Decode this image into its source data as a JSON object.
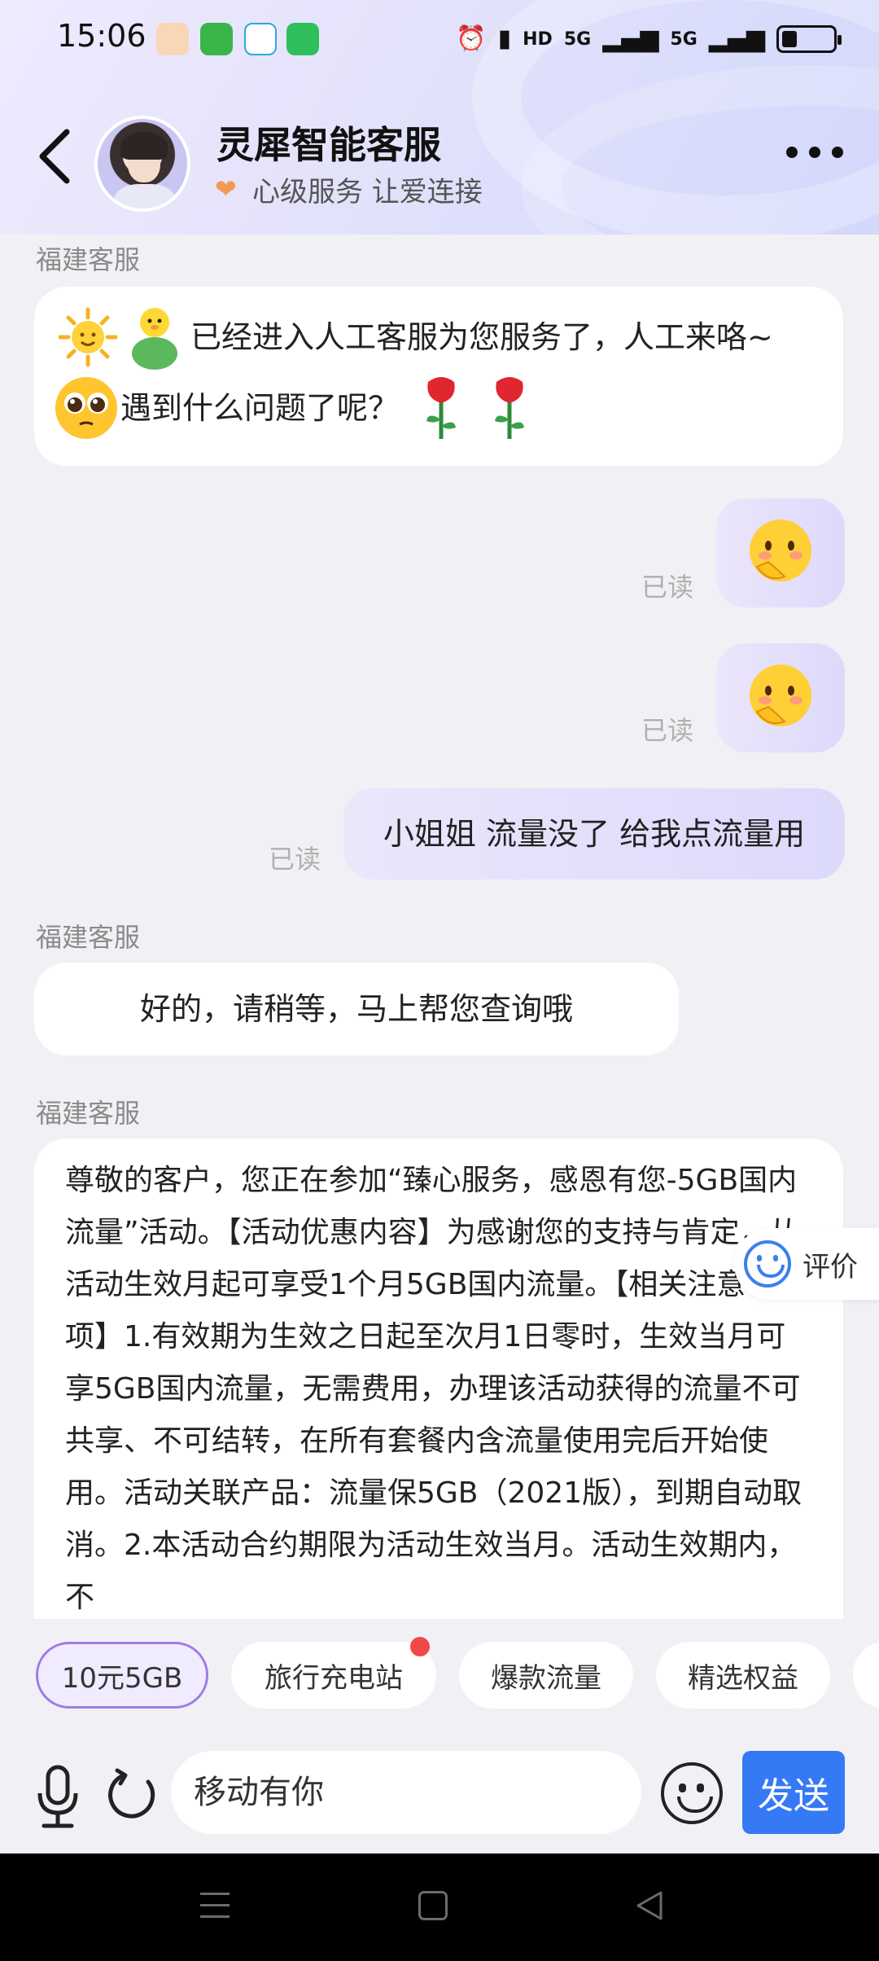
{
  "status_bar": {
    "time": "15:06",
    "network_hd": "HD",
    "network_5g_1": "5G",
    "network_5g_2": "5G"
  },
  "header": {
    "title": "灵犀智能客服",
    "subtitle": "心级服务 让爱连接"
  },
  "messages": {
    "sender_1": "福建客服",
    "welcome_line1": "已经进入人工客服为您服务了，人工来咯~",
    "welcome_line2": "遇到什么问题了呢？",
    "read_1": "已读",
    "read_2": "已读",
    "user_text": "小姐姐 流量没了 给我点流量用",
    "read_3": "已读",
    "sender_2": "福建客服",
    "reply_1": "好的，请稍等，马上帮您查询哦",
    "sender_3": "福建客服",
    "long_text": "尊敬的客户，您正在参加“臻心服务，感恩有您-5GB国内流量”活动。【活动优惠内容】为感谢您的支持与肯定，从活动生效月起可享受1个月5GB国内流量。【相关注意事项】1.有效期为生效之日起至次月1日零时，生效当月可享5GB国内流量，无需费用，办理该活动获得的流量不可共享、不可结转，在所有套餐内含流量使用完后开始使用。活动关联产品：流量保5GB（2021版），到期自动取消。2.本活动合约期限为活动生效当月。活动生效期内，不"
  },
  "rating": {
    "label": "评价"
  },
  "chips": [
    "10元5GB",
    "旅行充电站",
    "爆款流量",
    "精选权益"
  ],
  "input": {
    "value": "移动有你"
  },
  "send_label": "发送",
  "colors": {
    "accent": "#3679f5",
    "chip_active_border": "#a07be8",
    "badge": "#f24848"
  }
}
